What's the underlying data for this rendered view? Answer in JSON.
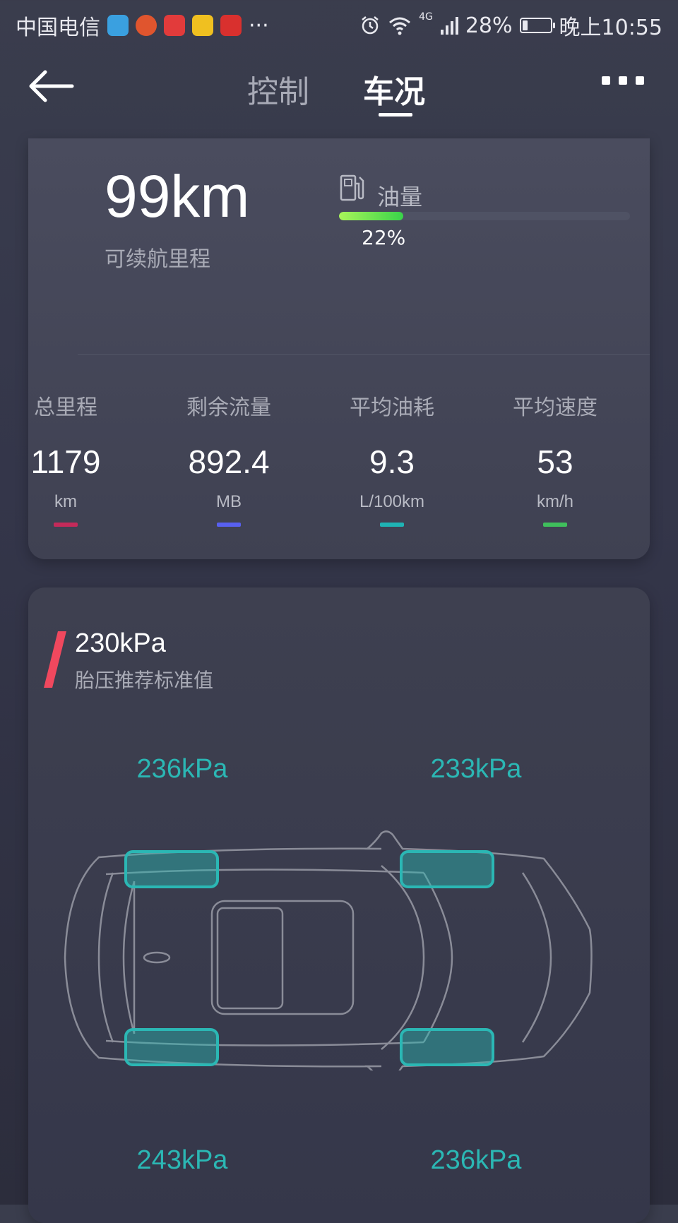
{
  "status_bar": {
    "carrier": "中国电信",
    "more": "···",
    "network": "4G",
    "battery_percent": "28%",
    "battery_level": 0.28,
    "time": "晚上10:55"
  },
  "nav": {
    "tabs": [
      {
        "label": "控制",
        "active": false
      },
      {
        "label": "车况",
        "active": true
      }
    ]
  },
  "summary": {
    "range_value": "99km",
    "range_label": "可续航里程",
    "fuel_label": "油量",
    "fuel_percent": "22%",
    "fuel_level": 0.22
  },
  "stats": [
    {
      "label": "总里程",
      "value": "1179",
      "unit": "km",
      "color": "#c42a5a"
    },
    {
      "label": "剩余流量",
      "value": "892.4",
      "unit": "MB",
      "color": "#5860f0"
    },
    {
      "label": "平均油耗",
      "value": "9.3",
      "unit": "L/100km",
      "color": "#1fb3b4"
    },
    {
      "label": "平均速度",
      "value": "53",
      "unit": "km/h",
      "color": "#3fbf5c"
    }
  ],
  "tire_pressure": {
    "standard_value": "230kPa",
    "standard_label": "胎压推荐标准值",
    "front_left": "236kPa",
    "front_right": "233kPa",
    "rear_left": "243kPa",
    "rear_right": "236kPa",
    "tire_color": "#2bb7b4",
    "flag_color": "#f0485e"
  }
}
